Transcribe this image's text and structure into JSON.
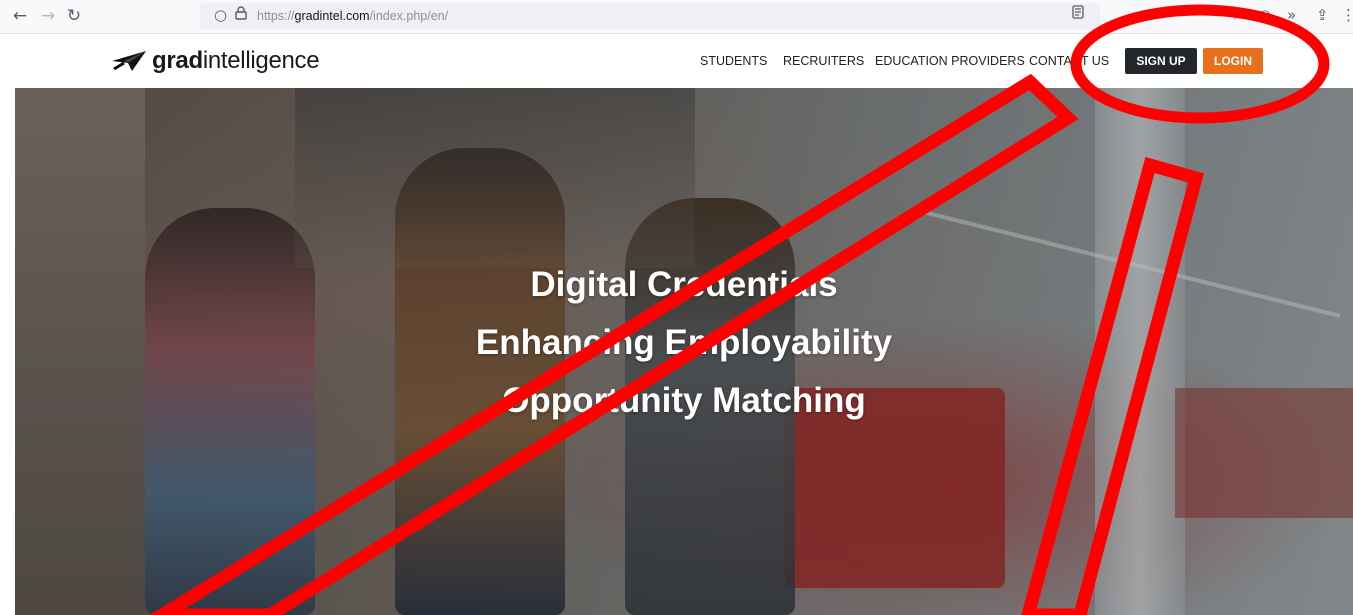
{
  "browser": {
    "url_prefix": "https://",
    "url_domain": "gradintel.com",
    "url_path": "/index.php/en/"
  },
  "site": {
    "logo": {
      "bold": "grad",
      "regular": "intelligence"
    },
    "nav": [
      "STUDENTS",
      "RECRUITERS",
      "EDUCATION PROVIDERS",
      "CONTACT US"
    ],
    "signup_label": "SIGN UP",
    "login_label": "LOGIN",
    "colors": {
      "signup": "#23262b",
      "login": "#e86f1c",
      "annotation": "#ff0000"
    }
  },
  "hero": {
    "lines": [
      "Digital Credentials",
      "Enhancing Employability",
      "Opportunity Matching"
    ]
  }
}
